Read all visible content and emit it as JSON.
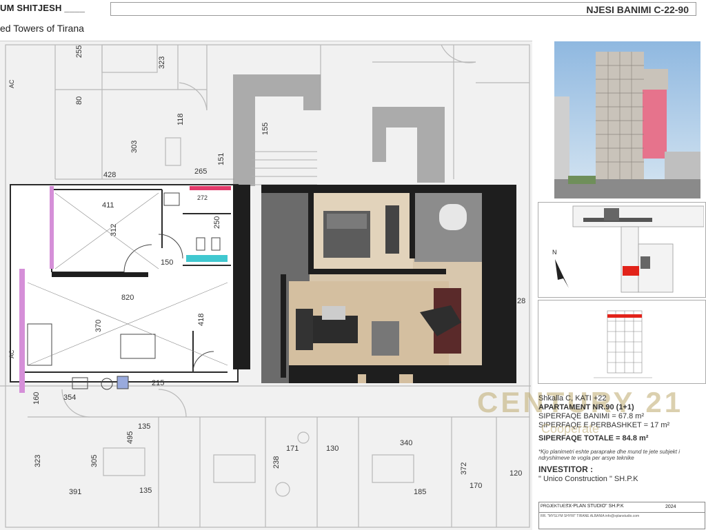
{
  "header": {
    "title_left": "UM SHITJESH ____",
    "subtitle_left": "ed  Towers of Tirana",
    "unit_code": "NJESI BANIMI C-22-90"
  },
  "plan": {
    "dimensions": {
      "d255": "255",
      "d323a": "323",
      "d80": "80",
      "d118": "118",
      "d303": "303",
      "d155": "155",
      "d428": "428",
      "d265": "265",
      "d151": "151",
      "d411": "411",
      "d312": "312",
      "d250": "250",
      "d150": "150",
      "d820": "820",
      "d370": "370",
      "d418": "418",
      "d215": "215",
      "d354": "354",
      "d160": "160",
      "d135a": "135",
      "d135b": "135",
      "d495": "495",
      "d323b": "323",
      "d305": "305",
      "d171": "171",
      "d130": "130",
      "d340": "340",
      "d238": "238",
      "d372": "372",
      "d170": "170",
      "d120": "120",
      "d391": "391",
      "d185": "185",
      "d28": "28",
      "d272": "272"
    },
    "labels": {
      "ac1": "AC",
      "ac2": "AC"
    }
  },
  "keyplan": {
    "north": "N"
  },
  "info": {
    "stair": "Shkalla C, KATI +22",
    "apartment": "APARTAMENT NR.90 (1+1)",
    "area_living": "SIPERFAQE BANIMI = 67.8 m²",
    "area_shared": "SIPERFAQE E PERBASHKET = 17 m²",
    "area_total": "SIPERFAQE TOTALE = 84.8 m²",
    "note": "*Kjo planimetri eshte paraprake dhe mund te jete subjekt i ndryshimeve te vogla per arsye teknike",
    "investor_title": "INVESTITOR :",
    "investor_name": "\" Unico Construction \" SH.P.K"
  },
  "watermark": {
    "brand": "CENTURY 21",
    "sub": "Cooperate"
  },
  "footer": {
    "proj_label": "PROJEKTUES :",
    "proj_name": "\"X-PLAN STUDIO\" SH.P.K",
    "year": "2024",
    "small": "RR. \"MYSLYM SHYRI\" TIRANE ALBANIA  info@xplanstudio.com"
  },
  "colors": {
    "accent_red": "#e2231a",
    "wall_dark": "#1e1e1e",
    "plan_bg": "#f1f1f1",
    "gold": "#bfa86e"
  }
}
